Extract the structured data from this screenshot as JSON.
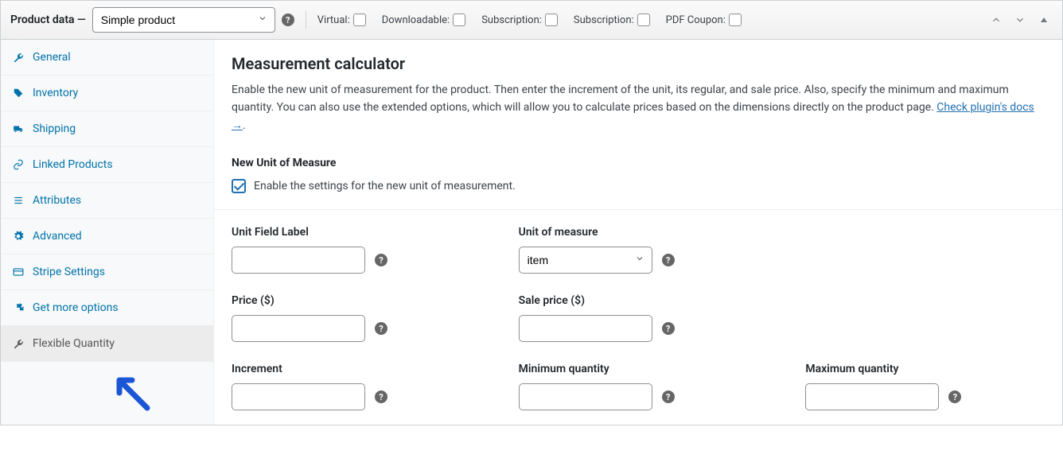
{
  "header": {
    "title": "Product data —",
    "product_type": "Simple product",
    "options": [
      {
        "label": "Virtual:",
        "checked": false
      },
      {
        "label": "Downloadable:",
        "checked": false
      },
      {
        "label": "Subscription:",
        "checked": false
      },
      {
        "label": "Subscription:",
        "checked": false
      },
      {
        "label": "PDF Coupon:",
        "checked": false
      }
    ]
  },
  "sidebar": {
    "items": [
      {
        "label": "General",
        "icon": "wrench"
      },
      {
        "label": "Inventory",
        "icon": "tag"
      },
      {
        "label": "Shipping",
        "icon": "truck"
      },
      {
        "label": "Linked Products",
        "icon": "link"
      },
      {
        "label": "Attributes",
        "icon": "list"
      },
      {
        "label": "Advanced",
        "icon": "gear"
      },
      {
        "label": "Stripe Settings",
        "icon": "card"
      },
      {
        "label": "Get more options",
        "icon": "plug"
      },
      {
        "label": "Flexible Quantity",
        "icon": "wrench",
        "active": true
      }
    ]
  },
  "main": {
    "heading": "Measurement calculator",
    "description_pre": "Enable the new unit of measurement for the product. Then enter the increment of the unit, its regular, and sale price. Also, specify the minimum and maximum quantity. You can also use the extended options, which will allow you to calculate prices based on the dimensions directly on the product page. ",
    "docs_link": "Check plugin's docs →",
    "new_unit_heading": "New Unit of Measure",
    "enable_label": "Enable the settings for the new unit of measurement.",
    "enable_checked": true,
    "fields": {
      "unit_field_label": {
        "label": "Unit Field Label",
        "value": ""
      },
      "unit_of_measure": {
        "label": "Unit of measure",
        "value": "item"
      },
      "price": {
        "label": "Price ($)",
        "value": ""
      },
      "sale_price": {
        "label": "Sale price ($)",
        "value": ""
      },
      "increment": {
        "label": "Increment",
        "value": ""
      },
      "minimum_quantity": {
        "label": "Minimum quantity",
        "value": ""
      },
      "maximum_quantity": {
        "label": "Maximum quantity",
        "value": ""
      }
    }
  }
}
